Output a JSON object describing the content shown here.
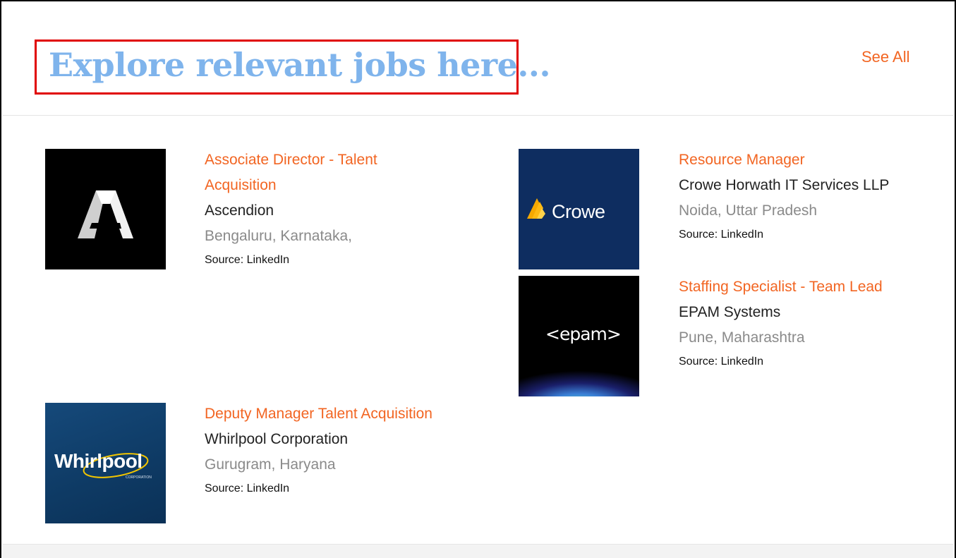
{
  "header": {
    "title": "Explore relevant jobs here...",
    "see_all_label": "See All"
  },
  "jobs": [
    {
      "title_line1": "Associate Director - Talent",
      "title_line2": "Acquisition",
      "company": "Ascendion",
      "location": "Bengaluru, Karnataka,",
      "source": "Source: LinkedIn",
      "logo_text": "A"
    },
    {
      "title": "Resource Manager",
      "company": "Crowe Horwath IT Services LLP",
      "location": "Noida, Uttar Pradesh",
      "source": "Source: LinkedIn",
      "logo_text": "Crowe"
    },
    {
      "title": "Staffing Specialist - Team Lead",
      "company": "EPAM Systems",
      "location": "Pune, Maharashtra",
      "source": "Source: LinkedIn",
      "logo_text": "<epam>"
    },
    {
      "title": "Deputy Manager Talent Acquisition",
      "company": "Whirlpool Corporation",
      "location": "Gurugram, Haryana",
      "source": "Source: LinkedIn",
      "logo_text": "Whirlpool",
      "logo_subtext": "CORPORATION"
    }
  ],
  "colors": {
    "accent": "#f26522",
    "title": "#7fb4ec",
    "highlight_border": "#e00000"
  }
}
